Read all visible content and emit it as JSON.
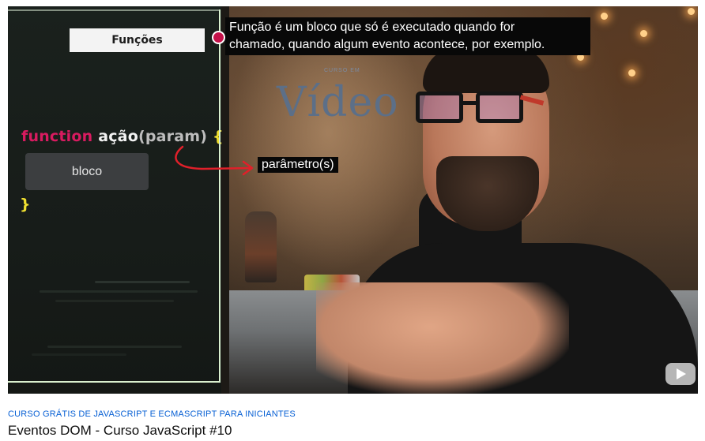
{
  "video": {
    "panel_title": "Funções",
    "code": {
      "keyword": "function",
      "name": "ação",
      "open_paren": "(",
      "param": "param",
      "close_paren": ")",
      "open_brace": "{",
      "block": "bloco",
      "close_brace": "}"
    },
    "caption": {
      "line1": "Função é um bloco que só é executado quando for",
      "line2": "chamado, quando algum evento acontece, por exemplo."
    },
    "param_label": "parâmetro(s)",
    "scene_logo": "Vídeo",
    "colors": {
      "keyword": "#d81b60",
      "brace": "#f0e030",
      "panel_bg": "#171c19",
      "arrow": "#e0202a"
    },
    "watermark_icon": "youtube-play-icon"
  },
  "series_link": "CURSO GRÁTIS DE JAVASCRIPT E ECMASCRIPT PARA INICIANTES",
  "title": "Eventos DOM - Curso JavaScript #10"
}
